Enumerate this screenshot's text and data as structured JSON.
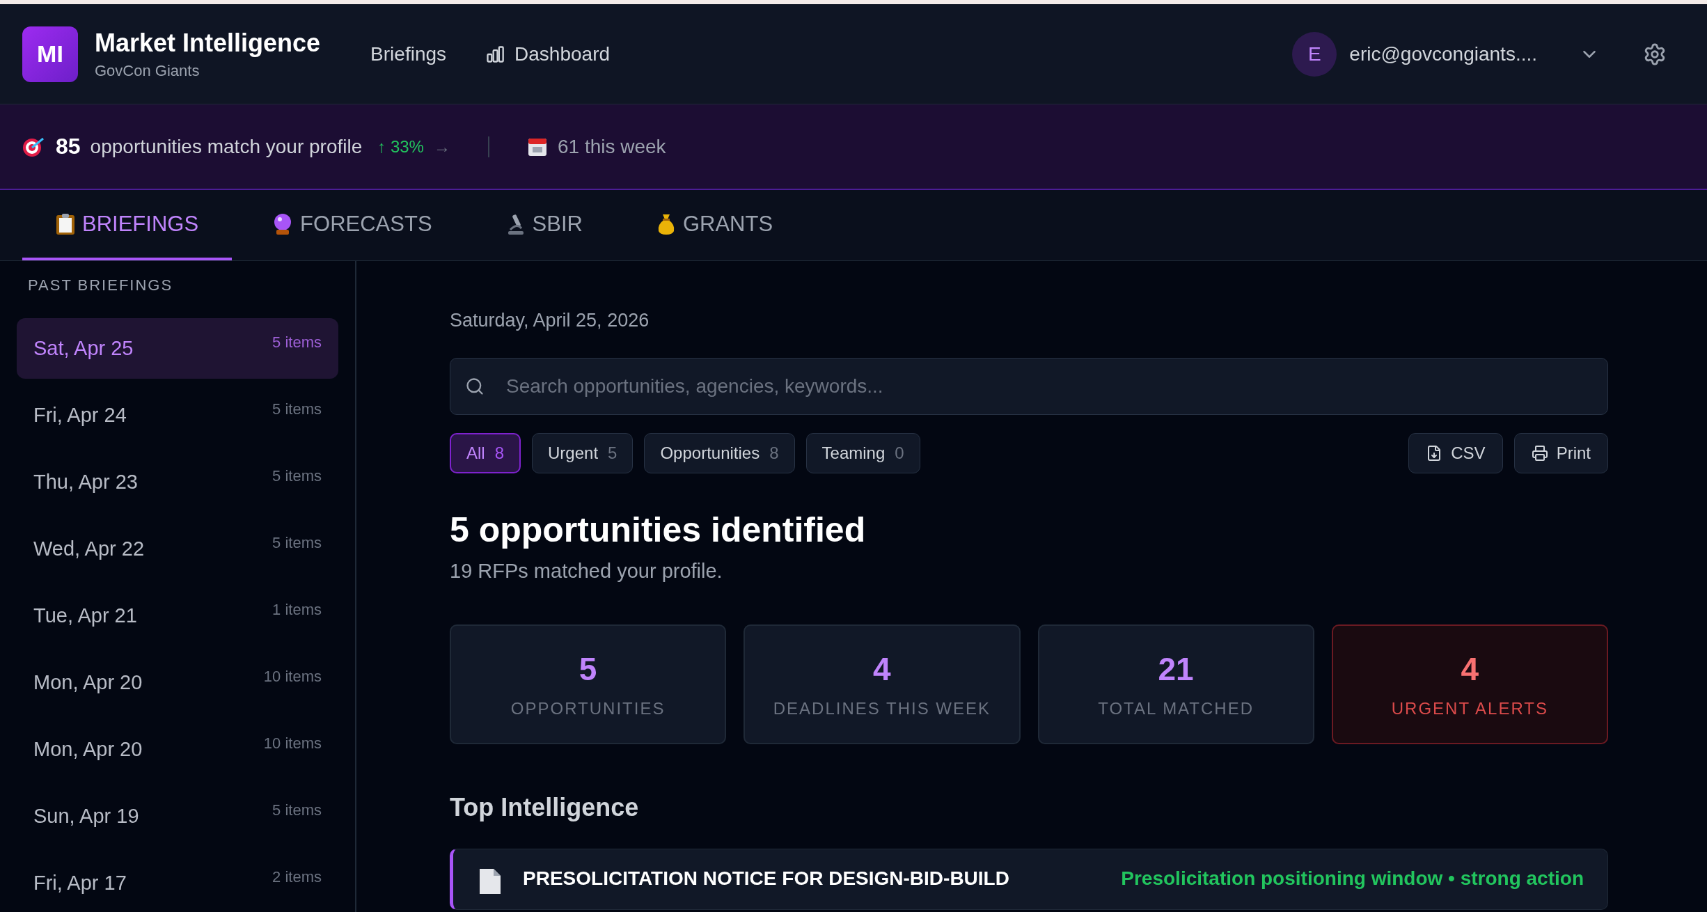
{
  "header": {
    "logo": "MI",
    "title": "Market Intelligence",
    "subtitle": "GovCon Giants",
    "nav": [
      {
        "label": "Briefings"
      },
      {
        "label": "Dashboard"
      }
    ],
    "user": {
      "initial": "E",
      "email": "eric@govcongiants...."
    }
  },
  "banner": {
    "count": "85",
    "text": "opportunities match your profile",
    "trend": "↑ 33%",
    "arrow": "→",
    "week": "61 this week"
  },
  "tabs": [
    {
      "label": "BRIEFINGS",
      "selected": true
    },
    {
      "label": "FORECASTS",
      "selected": false
    },
    {
      "label": "SBIR",
      "selected": false
    },
    {
      "label": "GRANTS",
      "selected": false
    }
  ],
  "sidebar": {
    "heading": "PAST BRIEFINGS",
    "items": [
      {
        "date": "Sat, Apr 25",
        "count": "5 items",
        "selected": true
      },
      {
        "date": "Fri, Apr 24",
        "count": "5 items",
        "selected": false
      },
      {
        "date": "Thu, Apr 23",
        "count": "5 items",
        "selected": false
      },
      {
        "date": "Wed, Apr 22",
        "count": "5 items",
        "selected": false
      },
      {
        "date": "Tue, Apr 21",
        "count": "1 items",
        "selected": false
      },
      {
        "date": "Mon, Apr 20",
        "count": "10 items",
        "selected": false
      },
      {
        "date": "Mon, Apr 20",
        "count": "10 items",
        "selected": false
      },
      {
        "date": "Sun, Apr 19",
        "count": "5 items",
        "selected": false
      },
      {
        "date": "Fri, Apr 17",
        "count": "2 items",
        "selected": false
      }
    ]
  },
  "main": {
    "date": "Saturday, April 25, 2026",
    "search": {
      "placeholder": "Search opportunities, agencies, keywords..."
    },
    "filters": [
      {
        "label": "All",
        "count": "8",
        "selected": true
      },
      {
        "label": "Urgent",
        "count": "5",
        "selected": false
      },
      {
        "label": "Opportunities",
        "count": "8",
        "selected": false
      },
      {
        "label": "Teaming",
        "count": "0",
        "selected": false
      }
    ],
    "actions": [
      {
        "label": "CSV"
      },
      {
        "label": "Print"
      }
    ],
    "heading": "5 opportunities identified",
    "subheading": "19 RFPs matched your profile.",
    "stats": [
      {
        "value": "5",
        "label": "OPPORTUNITIES",
        "kind": "normal"
      },
      {
        "value": "4",
        "label": "DEADLINES THIS WEEK",
        "kind": "normal"
      },
      {
        "value": "21",
        "label": "TOTAL MATCHED",
        "kind": "normal"
      },
      {
        "value": "4",
        "label": "URGENT ALERTS",
        "kind": "alert"
      }
    ],
    "section": "Top Intelligence",
    "cards": [
      {
        "title": "PRESOLICITATION NOTICE FOR DESIGN-BID-BUILD",
        "note": "Presolicitation positioning window • strong action"
      }
    ]
  }
}
